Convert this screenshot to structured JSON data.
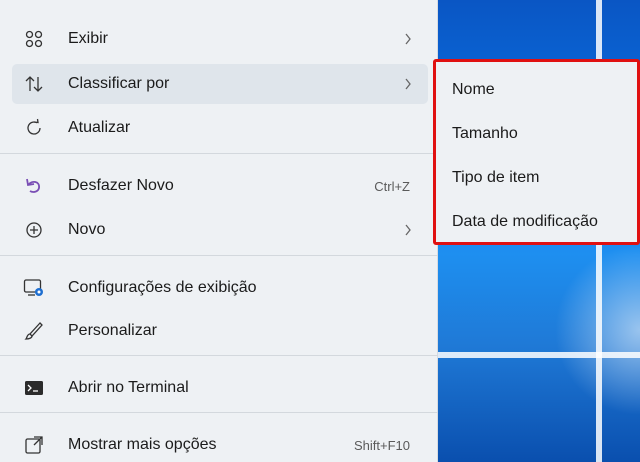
{
  "menu": {
    "items": [
      {
        "label": "Exibir",
        "icon": "grid-view-icon",
        "has_submenu": true
      },
      {
        "label": "Classificar por",
        "icon": "sort-arrows-icon",
        "has_submenu": true
      },
      {
        "label": "Atualizar",
        "icon": "refresh-icon",
        "has_submenu": false
      },
      {
        "label": "Desfazer Novo",
        "icon": "undo-icon",
        "shortcut": "Ctrl+Z"
      },
      {
        "label": "Novo",
        "icon": "add-circle-icon",
        "has_submenu": true
      },
      {
        "label": "Configurações de exibição",
        "icon": "display-settings-icon"
      },
      {
        "label": "Personalizar",
        "icon": "paint-brush-icon"
      },
      {
        "label": "Abrir no Terminal",
        "icon": "terminal-icon"
      },
      {
        "label": "Mostrar mais opções",
        "icon": "show-more-icon",
        "shortcut": "Shift+F10"
      }
    ]
  },
  "submenu": {
    "items": [
      "Nome",
      "Tamanho",
      "Tipo de item",
      "Data de modificação"
    ]
  },
  "colors": {
    "highlight_border": "#e01010",
    "menu_background": "#eef1f4",
    "wallpaper_blue": "#0b6fe0"
  }
}
